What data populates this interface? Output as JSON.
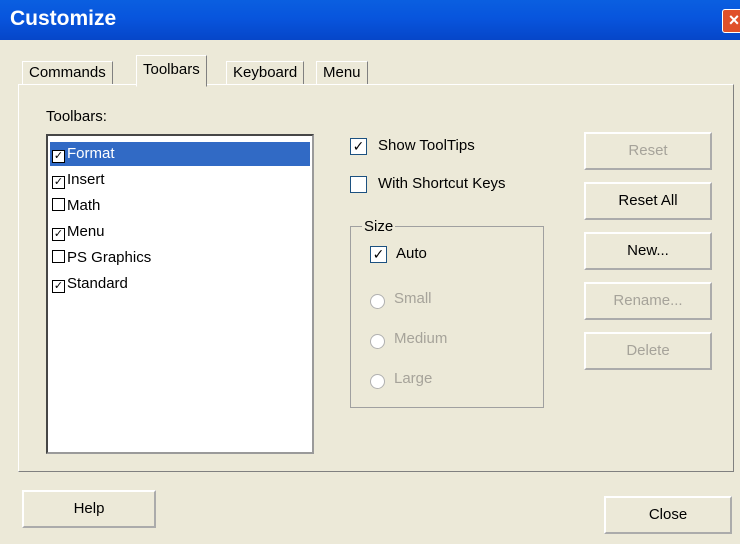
{
  "window": {
    "title": "Customize",
    "close_glyph": "×"
  },
  "tabs": [
    "Commands",
    "Toolbars",
    "Keyboard",
    "Menu"
  ],
  "toolbars_label": "Toolbars:",
  "toolbar_items": [
    {
      "label": "Format",
      "checked": true,
      "selected": true
    },
    {
      "label": "Insert",
      "checked": true,
      "selected": false
    },
    {
      "label": "Math",
      "checked": false,
      "selected": false
    },
    {
      "label": "Menu",
      "checked": true,
      "selected": false
    },
    {
      "label": "PS Graphics",
      "checked": false,
      "selected": false
    },
    {
      "label": "Standard",
      "checked": true,
      "selected": false
    }
  ],
  "options": {
    "show_tooltips": {
      "label": "Show ToolTips",
      "checked": true
    },
    "with_shortcut_keys": {
      "label": "With Shortcut Keys",
      "checked": false
    }
  },
  "size": {
    "title": "Size",
    "auto": {
      "label": "Auto",
      "checked": true
    },
    "small": "Small",
    "medium": "Medium",
    "large": "Large"
  },
  "buttons": {
    "reset": "Reset",
    "reset_all": "Reset All",
    "new": "New...",
    "rename": "Rename...",
    "delete": "Delete",
    "help": "Help",
    "close": "Close"
  }
}
